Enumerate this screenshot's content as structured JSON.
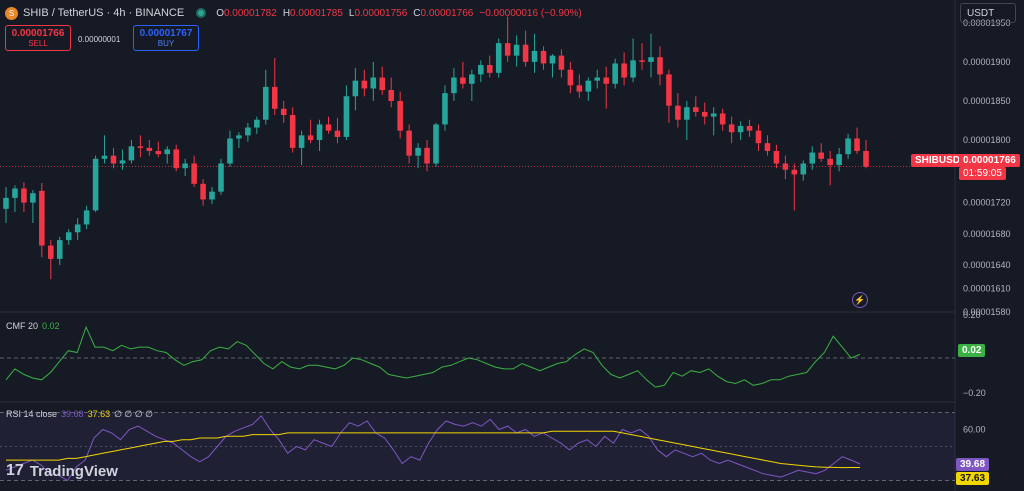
{
  "header": {
    "symbol": "SHIB / TetherUS · 4h · BINANCE",
    "coin_glyph": "S",
    "ohlc": {
      "o_key": "O",
      "o_val": "0.00001782",
      "h_key": "H",
      "h_val": "0.00001785",
      "l_key": "L",
      "l_val": "0.00001756",
      "c_key": "C",
      "c_val": "0.00001766",
      "change": "−0.00000016 (−0.90%)"
    }
  },
  "trade": {
    "sell_price": "0.00001766",
    "sell_label": "SELL",
    "spread": "0.00000001",
    "buy_price": "0.00001767",
    "buy_label": "BUY"
  },
  "currency": "USDT",
  "price_axis": {
    "ticks": [
      "0.00001950",
      "0.00001900",
      "0.00001850",
      "0.00001800",
      "0.00001720",
      "0.00001680",
      "0.00001640",
      "0.00001610",
      "0.00001580"
    ],
    "symbol_tag": "SHIBUSDT",
    "last_price_tag": "0.00001766",
    "countdown_tag": "01:59:05"
  },
  "cmf": {
    "label": "CMF 20",
    "value": "0.02",
    "axis_top": "0.20",
    "axis_bottom": "−0.20",
    "tag": "0.02"
  },
  "rsi": {
    "label": "RSI 14 close",
    "value1": "39.68",
    "value2": "37.63",
    "extras": "∅ ∅ ∅ ∅",
    "axis_tick": "60.00",
    "tag1": "39.68",
    "tag2": "37.63"
  },
  "brand": {
    "mark": "17",
    "name": "TradingView"
  },
  "colors": {
    "background": "#161a25",
    "up": "#26a69a",
    "down": "#f23645",
    "cmf_line": "#3bb143",
    "rsi_line": "#7e57c2",
    "rsi_ma": "#f2d600"
  },
  "chart_data": {
    "type": "candlestick",
    "ylim": [
      1.58e-05,
      1.96e-05
    ],
    "candles": [
      {
        "o": 1.712e-05,
        "h": 1.74e-05,
        "l": 1.694e-05,
        "c": 1.726e-05
      },
      {
        "o": 1.726e-05,
        "h": 1.742e-05,
        "l": 1.708e-05,
        "c": 1.738e-05
      },
      {
        "o": 1.738e-05,
        "h": 1.746e-05,
        "l": 1.708e-05,
        "c": 1.72e-05
      },
      {
        "o": 1.72e-05,
        "h": 1.736e-05,
        "l": 1.694e-05,
        "c": 1.732e-05
      },
      {
        "o": 1.735e-05,
        "h": 1.745e-05,
        "l": 1.65e-05,
        "c": 1.665e-05
      },
      {
        "o": 1.665e-05,
        "h": 1.672e-05,
        "l": 1.622e-05,
        "c": 1.648e-05
      },
      {
        "o": 1.648e-05,
        "h": 1.676e-05,
        "l": 1.64e-05,
        "c": 1.672e-05
      },
      {
        "o": 1.672e-05,
        "h": 1.686e-05,
        "l": 1.666e-05,
        "c": 1.682e-05
      },
      {
        "o": 1.682e-05,
        "h": 1.7e-05,
        "l": 1.672e-05,
        "c": 1.692e-05
      },
      {
        "o": 1.692e-05,
        "h": 1.716e-05,
        "l": 1.686e-05,
        "c": 1.71e-05
      },
      {
        "o": 1.71e-05,
        "h": 1.78e-05,
        "l": 1.708e-05,
        "c": 1.776e-05
      },
      {
        "o": 1.776e-05,
        "h": 1.806e-05,
        "l": 1.77e-05,
        "c": 1.78e-05
      },
      {
        "o": 1.78e-05,
        "h": 1.79e-05,
        "l": 1.764e-05,
        "c": 1.77e-05
      },
      {
        "o": 1.77e-05,
        "h": 1.788e-05,
        "l": 1.762e-05,
        "c": 1.774e-05
      },
      {
        "o": 1.774e-05,
        "h": 1.8e-05,
        "l": 1.77e-05,
        "c": 1.792e-05
      },
      {
        "o": 1.792e-05,
        "h": 1.806e-05,
        "l": 1.778e-05,
        "c": 1.79e-05
      },
      {
        "o": 1.79e-05,
        "h": 1.8e-05,
        "l": 1.78e-05,
        "c": 1.786e-05
      },
      {
        "o": 1.786e-05,
        "h": 1.798e-05,
        "l": 1.778e-05,
        "c": 1.782e-05
      },
      {
        "o": 1.782e-05,
        "h": 1.792e-05,
        "l": 1.77e-05,
        "c": 1.788e-05
      },
      {
        "o": 1.788e-05,
        "h": 1.794e-05,
        "l": 1.76e-05,
        "c": 1.764e-05
      },
      {
        "o": 1.764e-05,
        "h": 1.776e-05,
        "l": 1.754e-05,
        "c": 1.77e-05
      },
      {
        "o": 1.77e-05,
        "h": 1.78e-05,
        "l": 1.74e-05,
        "c": 1.744e-05
      },
      {
        "o": 1.744e-05,
        "h": 1.75e-05,
        "l": 1.716e-05,
        "c": 1.724e-05
      },
      {
        "o": 1.724e-05,
        "h": 1.74e-05,
        "l": 1.718e-05,
        "c": 1.734e-05
      },
      {
        "o": 1.734e-05,
        "h": 1.776e-05,
        "l": 1.73e-05,
        "c": 1.77e-05
      },
      {
        "o": 1.77e-05,
        "h": 1.812e-05,
        "l": 1.766e-05,
        "c": 1.802e-05
      },
      {
        "o": 1.802e-05,
        "h": 1.81e-05,
        "l": 1.79e-05,
        "c": 1.806e-05
      },
      {
        "o": 1.806e-05,
        "h": 1.822e-05,
        "l": 1.798e-05,
        "c": 1.816e-05
      },
      {
        "o": 1.816e-05,
        "h": 1.83e-05,
        "l": 1.808e-05,
        "c": 1.826e-05
      },
      {
        "o": 1.826e-05,
        "h": 1.89e-05,
        "l": 1.82e-05,
        "c": 1.868e-05
      },
      {
        "o": 1.868e-05,
        "h": 1.905e-05,
        "l": 1.832e-05,
        "c": 1.84e-05
      },
      {
        "o": 1.84e-05,
        "h": 1.85e-05,
        "l": 1.822e-05,
        "c": 1.832e-05
      },
      {
        "o": 1.832e-05,
        "h": 1.842e-05,
        "l": 1.784e-05,
        "c": 1.79e-05
      },
      {
        "o": 1.79e-05,
        "h": 1.812e-05,
        "l": 1.768e-05,
        "c": 1.806e-05
      },
      {
        "o": 1.806e-05,
        "h": 1.826e-05,
        "l": 1.796e-05,
        "c": 1.8e-05
      },
      {
        "o": 1.8e-05,
        "h": 1.826e-05,
        "l": 1.786e-05,
        "c": 1.82e-05
      },
      {
        "o": 1.82e-05,
        "h": 1.83e-05,
        "l": 1.808e-05,
        "c": 1.812e-05
      },
      {
        "o": 1.812e-05,
        "h": 1.828e-05,
        "l": 1.796e-05,
        "c": 1.804e-05
      },
      {
        "o": 1.804e-05,
        "h": 1.87e-05,
        "l": 1.8e-05,
        "c": 1.856e-05
      },
      {
        "o": 1.856e-05,
        "h": 1.892e-05,
        "l": 1.838e-05,
        "c": 1.876e-05
      },
      {
        "o": 1.876e-05,
        "h": 1.89e-05,
        "l": 1.856e-05,
        "c": 1.866e-05
      },
      {
        "o": 1.866e-05,
        "h": 1.9e-05,
        "l": 1.85e-05,
        "c": 1.88e-05
      },
      {
        "o": 1.88e-05,
        "h": 1.894e-05,
        "l": 1.858e-05,
        "c": 1.864e-05
      },
      {
        "o": 1.864e-05,
        "h": 1.88e-05,
        "l": 1.842e-05,
        "c": 1.85e-05
      },
      {
        "o": 1.85e-05,
        "h": 1.862e-05,
        "l": 1.802e-05,
        "c": 1.812e-05
      },
      {
        "o": 1.812e-05,
        "h": 1.82e-05,
        "l": 1.77e-05,
        "c": 1.78e-05
      },
      {
        "o": 1.78e-05,
        "h": 1.796e-05,
        "l": 1.764e-05,
        "c": 1.79e-05
      },
      {
        "o": 1.79e-05,
        "h": 1.8e-05,
        "l": 1.76e-05,
        "c": 1.77e-05
      },
      {
        "o": 1.77e-05,
        "h": 1.822e-05,
        "l": 1.766e-05,
        "c": 1.82e-05
      },
      {
        "o": 1.82e-05,
        "h": 1.87e-05,
        "l": 1.812e-05,
        "c": 1.86e-05
      },
      {
        "o": 1.86e-05,
        "h": 1.892e-05,
        "l": 1.85e-05,
        "c": 1.88e-05
      },
      {
        "o": 1.88e-05,
        "h": 1.9e-05,
        "l": 1.866e-05,
        "c": 1.872e-05
      },
      {
        "o": 1.872e-05,
        "h": 1.89e-05,
        "l": 1.85e-05,
        "c": 1.884e-05
      },
      {
        "o": 1.884e-05,
        "h": 1.902e-05,
        "l": 1.874e-05,
        "c": 1.896e-05
      },
      {
        "o": 1.896e-05,
        "h": 1.908e-05,
        "l": 1.88e-05,
        "c": 1.886e-05
      },
      {
        "o": 1.886e-05,
        "h": 1.93e-05,
        "l": 1.88e-05,
        "c": 1.924e-05
      },
      {
        "o": 1.924e-05,
        "h": 1.958e-05,
        "l": 1.9e-05,
        "c": 1.908e-05
      },
      {
        "o": 1.908e-05,
        "h": 1.934e-05,
        "l": 1.894e-05,
        "c": 1.922e-05
      },
      {
        "o": 1.922e-05,
        "h": 1.94e-05,
        "l": 1.894e-05,
        "c": 1.9e-05
      },
      {
        "o": 1.9e-05,
        "h": 1.936e-05,
        "l": 1.886e-05,
        "c": 1.914e-05
      },
      {
        "o": 1.914e-05,
        "h": 1.92e-05,
        "l": 1.89e-05,
        "c": 1.898e-05
      },
      {
        "o": 1.898e-05,
        "h": 1.91e-05,
        "l": 1.88e-05,
        "c": 1.908e-05
      },
      {
        "o": 1.908e-05,
        "h": 1.916e-05,
        "l": 1.88e-05,
        "c": 1.89e-05
      },
      {
        "o": 1.89e-05,
        "h": 1.9e-05,
        "l": 1.86e-05,
        "c": 1.87e-05
      },
      {
        "o": 1.87e-05,
        "h": 1.884e-05,
        "l": 1.854e-05,
        "c": 1.862e-05
      },
      {
        "o": 1.862e-05,
        "h": 1.88e-05,
        "l": 1.85e-05,
        "c": 1.876e-05
      },
      {
        "o": 1.876e-05,
        "h": 1.89e-05,
        "l": 1.866e-05,
        "c": 1.88e-05
      },
      {
        "o": 1.88e-05,
        "h": 1.894e-05,
        "l": 1.84e-05,
        "c": 1.872e-05
      },
      {
        "o": 1.872e-05,
        "h": 1.904e-05,
        "l": 1.866e-05,
        "c": 1.898e-05
      },
      {
        "o": 1.898e-05,
        "h": 1.912e-05,
        "l": 1.87e-05,
        "c": 1.88e-05
      },
      {
        "o": 1.88e-05,
        "h": 1.93e-05,
        "l": 1.874e-05,
        "c": 1.902e-05
      },
      {
        "o": 1.902e-05,
        "h": 1.924e-05,
        "l": 1.89e-05,
        "c": 1.9e-05
      },
      {
        "o": 1.9e-05,
        "h": 1.936e-05,
        "l": 1.88e-05,
        "c": 1.906e-05
      },
      {
        "o": 1.906e-05,
        "h": 1.92e-05,
        "l": 1.87e-05,
        "c": 1.884e-05
      },
      {
        "o": 1.884e-05,
        "h": 1.89e-05,
        "l": 1.822e-05,
        "c": 1.844e-05
      },
      {
        "o": 1.844e-05,
        "h": 1.86e-05,
        "l": 1.816e-05,
        "c": 1.826e-05
      },
      {
        "o": 1.826e-05,
        "h": 1.85e-05,
        "l": 1.8e-05,
        "c": 1.842e-05
      },
      {
        "o": 1.842e-05,
        "h": 1.856e-05,
        "l": 1.83e-05,
        "c": 1.836e-05
      },
      {
        "o": 1.836e-05,
        "h": 1.848e-05,
        "l": 1.82e-05,
        "c": 1.83e-05
      },
      {
        "o": 1.83e-05,
        "h": 1.842e-05,
        "l": 1.806e-05,
        "c": 1.834e-05
      },
      {
        "o": 1.834e-05,
        "h": 1.84e-05,
        "l": 1.812e-05,
        "c": 1.82e-05
      },
      {
        "o": 1.82e-05,
        "h": 1.83e-05,
        "l": 1.796e-05,
        "c": 1.81e-05
      },
      {
        "o": 1.81e-05,
        "h": 1.824e-05,
        "l": 1.8e-05,
        "c": 1.818e-05
      },
      {
        "o": 1.818e-05,
        "h": 1.826e-05,
        "l": 1.804e-05,
        "c": 1.812e-05
      },
      {
        "o": 1.812e-05,
        "h": 1.82e-05,
        "l": 1.786e-05,
        "c": 1.796e-05
      },
      {
        "o": 1.796e-05,
        "h": 1.806e-05,
        "l": 1.78e-05,
        "c": 1.786e-05
      },
      {
        "o": 1.786e-05,
        "h": 1.794e-05,
        "l": 1.764e-05,
        "c": 1.77e-05
      },
      {
        "o": 1.77e-05,
        "h": 1.78e-05,
        "l": 1.75e-05,
        "c": 1.762e-05
      },
      {
        "o": 1.762e-05,
        "h": 1.77e-05,
        "l": 1.71e-05,
        "c": 1.756e-05
      },
      {
        "o": 1.756e-05,
        "h": 1.774e-05,
        "l": 1.748e-05,
        "c": 1.77e-05
      },
      {
        "o": 1.77e-05,
        "h": 1.792e-05,
        "l": 1.762e-05,
        "c": 1.784e-05
      },
      {
        "o": 1.784e-05,
        "h": 1.796e-05,
        "l": 1.772e-05,
        "c": 1.776e-05
      },
      {
        "o": 1.776e-05,
        "h": 1.786e-05,
        "l": 1.742e-05,
        "c": 1.768e-05
      },
      {
        "o": 1.768e-05,
        "h": 1.79e-05,
        "l": 1.76e-05,
        "c": 1.782e-05
      },
      {
        "o": 1.782e-05,
        "h": 1.808e-05,
        "l": 1.776e-05,
        "c": 1.802e-05
      },
      {
        "o": 1.802e-05,
        "h": 1.816e-05,
        "l": 1.782e-05,
        "c": 1.786e-05
      },
      {
        "o": 1.786e-05,
        "h": 1.8e-05,
        "l": 1.764e-05,
        "c": 1.766e-05
      }
    ],
    "last_price": 1.766e-05,
    "cmf_ylim": [
      -0.22,
      0.22
    ],
    "cmf": [
      -0.12,
      -0.06,
      -0.09,
      -0.11,
      -0.12,
      -0.08,
      -0.02,
      0.04,
      0.03,
      0.17,
      0.06,
      0.06,
      0.04,
      0.07,
      0.05,
      0.06,
      0.06,
      0.04,
      0.03,
      -0.01,
      -0.04,
      -0.02,
      -0.01,
      0.04,
      0.06,
      0.05,
      0.09,
      0.07,
      0.02,
      -0.03,
      -0.06,
      -0.02,
      -0.05,
      -0.06,
      -0.04,
      -0.04,
      -0.05,
      -0.06,
      -0.04,
      0.0,
      -0.01,
      -0.03,
      -0.05,
      -0.09,
      -0.1,
      -0.11,
      -0.1,
      -0.09,
      -0.08,
      -0.05,
      -0.04,
      -0.02,
      0.0,
      -0.01,
      -0.03,
      -0.05,
      -0.06,
      -0.06,
      -0.03,
      -0.05,
      -0.07,
      -0.05,
      -0.03,
      -0.02,
      0.02,
      0.05,
      0.03,
      -0.04,
      -0.09,
      -0.11,
      -0.09,
      -0.07,
      -0.12,
      -0.16,
      -0.15,
      -0.08,
      -0.1,
      -0.07,
      -0.08,
      -0.06,
      -0.1,
      -0.13,
      -0.14,
      -0.12,
      -0.15,
      -0.14,
      -0.12,
      -0.12,
      -0.1,
      -0.09,
      -0.08,
      -0.02,
      0.03,
      0.12,
      0.06,
      0.0,
      0.02
    ],
    "rsi_ylim": [
      25,
      75
    ],
    "rsi": [
      36,
      38,
      40,
      42,
      39,
      34,
      33,
      30,
      38,
      42,
      55,
      60,
      58,
      54,
      60,
      62,
      59,
      56,
      54,
      52,
      48,
      44,
      41,
      44,
      50,
      56,
      59,
      61,
      63,
      68,
      60,
      54,
      46,
      50,
      48,
      54,
      52,
      50,
      58,
      64,
      62,
      65,
      58,
      55,
      48,
      40,
      44,
      42,
      52,
      60,
      65,
      63,
      62,
      64,
      62,
      66,
      60,
      62,
      58,
      60,
      56,
      58,
      55,
      52,
      48,
      52,
      54,
      50,
      56,
      52,
      60,
      58,
      60,
      56,
      48,
      44,
      48,
      46,
      44,
      46,
      42,
      40,
      42,
      40,
      38,
      36,
      34,
      33,
      32,
      34,
      36,
      35,
      34,
      36,
      40,
      44,
      42,
      39.68
    ],
    "rsi_ma": [
      42,
      42,
      42,
      42,
      42,
      42,
      42,
      43,
      43,
      44,
      45,
      46,
      47,
      48,
      49,
      50,
      51,
      52,
      53,
      53,
      54,
      54,
      55,
      55,
      55,
      56,
      56,
      56,
      57,
      57,
      57,
      57,
      58,
      58,
      58,
      58,
      58,
      58,
      58,
      58,
      58,
      58,
      58,
      58,
      58,
      58,
      58,
      58,
      58,
      58,
      58,
      58,
      58,
      58,
      58,
      58,
      58,
      58,
      58,
      58,
      58,
      58,
      59,
      59,
      59,
      59,
      59,
      59,
      59,
      59,
      58,
      57,
      56,
      55,
      54,
      53,
      52,
      51,
      50,
      49,
      48,
      47,
      46,
      45,
      44,
      43,
      42,
      41,
      40,
      39.5,
      39,
      38.5,
      38,
      37.8,
      37.7,
      37.6,
      37.63,
      37.63
    ]
  }
}
